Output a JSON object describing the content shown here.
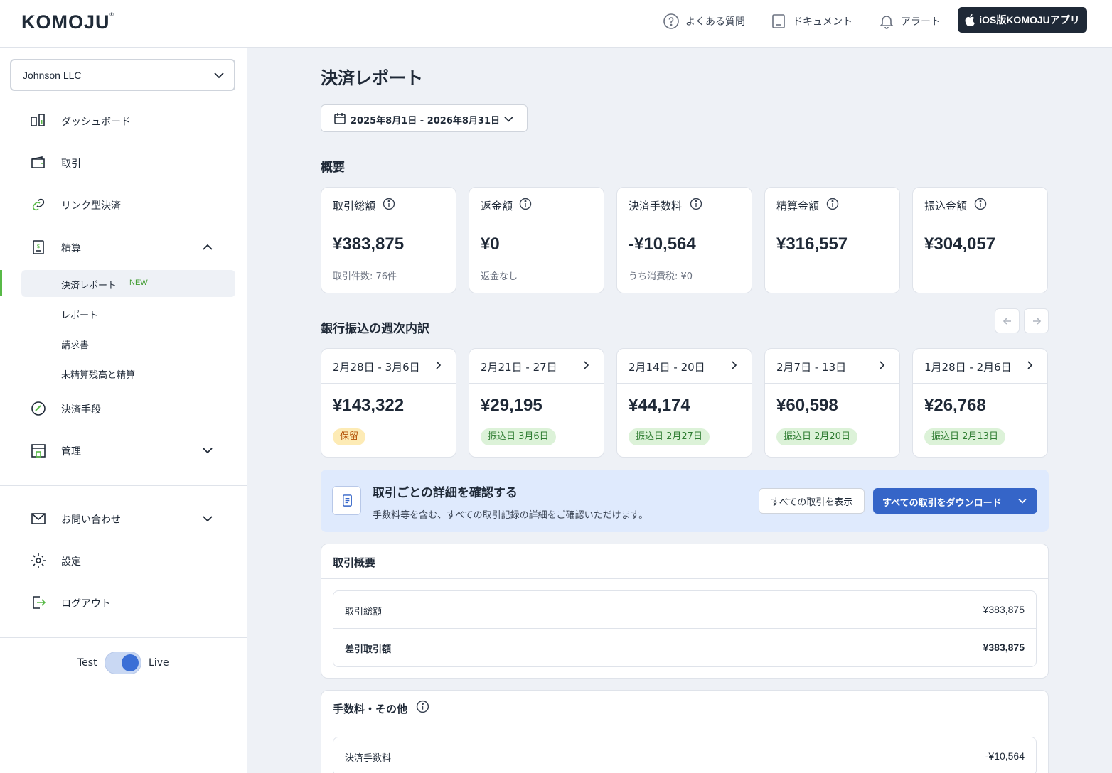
{
  "header": {
    "logo": "KOMOJU",
    "logo_mark": "®",
    "faq": "よくある質問",
    "docs": "ドキュメント",
    "alerts": "アラート",
    "ios_app": "iOS版KOMOJUアプリ"
  },
  "sidebar": {
    "account": "Johnson LLC",
    "items": {
      "dashboard": "ダッシュボード",
      "transactions": "取引",
      "link_payments": "リンク型決済",
      "settlement": "精算",
      "payment_methods": "決済手段",
      "management": "管理",
      "contact": "お問い合わせ",
      "settings": "設定",
      "logout": "ログアウト"
    },
    "settlement_sub": {
      "payment_report": "決済レポート",
      "new_badge": "NEW",
      "report": "レポート",
      "invoice": "請求書",
      "unsettled": "未精算残高と精算"
    },
    "mode": {
      "test": "Test",
      "live": "Live",
      "live_enabled": true
    }
  },
  "main": {
    "title": "決済レポート",
    "date_range": "2025年8月1日 - 2026年8月31日",
    "overview_heading": "概要",
    "summary_cards": [
      {
        "title": "取引総額",
        "amount": "¥383,875",
        "sub": "取引件数: 76件"
      },
      {
        "title": "返金額",
        "amount": "¥0",
        "sub": "返金なし"
      },
      {
        "title": "決済手数料",
        "amount": "-¥10,564",
        "sub": "うち消費税: ¥0"
      },
      {
        "title": "精算金額",
        "amount": "¥316,557",
        "sub": ""
      },
      {
        "title": "振込金額",
        "amount": "¥304,057",
        "sub": ""
      }
    ],
    "weekly_heading": "銀行振込の週次内訳",
    "weekly_cards": [
      {
        "range": "2月28日 - 3月6日",
        "amount": "¥143,322",
        "status": "保留",
        "status_type": "hold"
      },
      {
        "range": "2月21日 - 27日",
        "amount": "¥29,195",
        "status": "振込日 3月6日",
        "status_type": "paid"
      },
      {
        "range": "2月14日 - 20日",
        "amount": "¥44,174",
        "status": "振込日 2月27日",
        "status_type": "paid"
      },
      {
        "range": "2月7日 - 13日",
        "amount": "¥60,598",
        "status": "振込日 2月20日",
        "status_type": "paid"
      },
      {
        "range": "1月28日 - 2月6日",
        "amount": "¥26,768",
        "status": "振込日 2月13日",
        "status_type": "paid"
      }
    ],
    "banner": {
      "title": "取引ごとの詳細を確認する",
      "desc": "手数料等を含む、すべての取引記録の詳細をご確認いただけます。",
      "view_all": "すべての取引を表示",
      "download_all": "すべての取引をダウンロード"
    },
    "transaction_summary": {
      "title": "取引概要",
      "rows": [
        {
          "label": "取引総額",
          "value": "¥383,875"
        },
        {
          "label": "差引取引額",
          "value": "¥383,875"
        }
      ]
    },
    "fees": {
      "title": "手数料・その他",
      "rows": [
        {
          "label": "決済手数料",
          "value": "-¥10,564"
        }
      ]
    }
  },
  "colors": {
    "accent_blue": "#3565c8",
    "active_green": "#58b947",
    "hold_bg": "#fdebb5",
    "paid_bg": "#dcf2d8",
    "banner_bg": "#dfeafd"
  }
}
